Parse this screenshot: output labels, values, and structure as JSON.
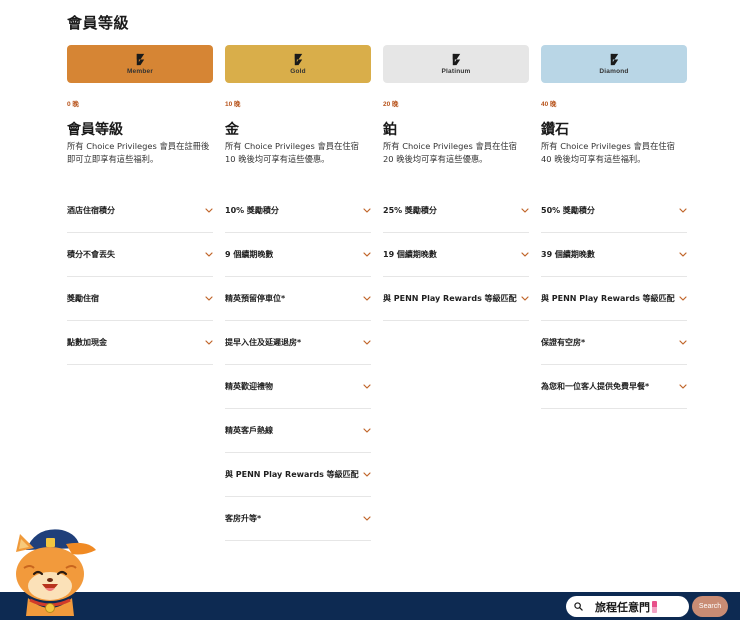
{
  "page": {
    "title": "會員等級"
  },
  "tiers": [
    {
      "card_label": "Member",
      "card_color": "#d68534",
      "nights": "0 晚",
      "heading": "會員等級",
      "description": "所有 Choice Privileges 會員在註冊後即可立即享有這些福利。",
      "benefits": [
        "酒店住宿積分",
        "積分不會丟失",
        "獎勵住宿",
        "點數加現金"
      ]
    },
    {
      "card_label": "Gold",
      "card_color": "#d9ae4a",
      "nights": "10 晚",
      "heading": "金",
      "description": "所有 Choice Privileges 會員在住宿 10 晚後均可享有這些優惠。",
      "benefits": [
        "10% 獎勵積分",
        "9 個續期晚數",
        "精英預留停車位*",
        "提早入住及延遲退房*",
        "精英歡迎禮物",
        "精英客戶熱線",
        "與 PENN Play Rewards 等級匹配",
        "客房升等*"
      ]
    },
    {
      "card_label": "Platinum",
      "card_color": "#e6e6e6",
      "nights": "20 晚",
      "heading": "鉑",
      "description": "所有 Choice Privileges 會員在住宿 20 晚後均可享有這些優惠。",
      "benefits": [
        "25% 獎勵積分",
        "19 個續期晚數",
        "與 PENN Play Rewards 等級匹配"
      ]
    },
    {
      "card_label": "Diamond",
      "card_color": "#b9d6e6",
      "nights": "40 晚",
      "heading": "鑽石",
      "description": "所有 Choice Privileges 會員在住宿 40 晚後均可享有這些福利。",
      "benefits": [
        "50% 獎勵積分",
        "39 個續期晚數",
        "與 PENN Play Rewards 等級匹配",
        "保證有空房*",
        "為您和一位客人提供免費早餐*"
      ]
    }
  ],
  "search": {
    "text": "旅程任意門",
    "button_label": "Search"
  },
  "colors": {
    "accent": "#b8541c",
    "footer": "#0d2a52",
    "search_button": "#c98c74"
  },
  "icons": {
    "tier_logo": "choice-logo-icon",
    "chevron": "chevron-down-icon",
    "search": "search-icon",
    "mascot": "cat-mascot-icon"
  }
}
